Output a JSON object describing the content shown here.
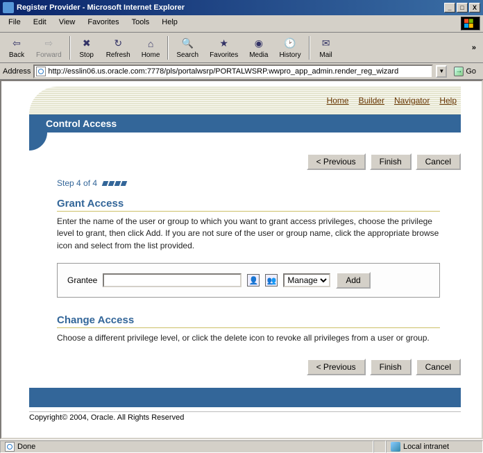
{
  "window": {
    "title": "Register Provider - Microsoft Internet Explorer"
  },
  "menubar": {
    "file": "File",
    "edit": "Edit",
    "view": "View",
    "favorites": "Favorites",
    "tools": "Tools",
    "help": "Help"
  },
  "toolbar": {
    "back": "Back",
    "forward": "Forward",
    "stop": "Stop",
    "refresh": "Refresh",
    "home": "Home",
    "search": "Search",
    "favorites": "Favorites",
    "media": "Media",
    "history": "History",
    "mail": "Mail"
  },
  "address": {
    "label": "Address",
    "url": "http://esslin06.us.oracle.com:7778/pls/portalwsrp/PORTALWSRP.wwpro_app_admin.render_reg_wizard",
    "go": "Go"
  },
  "nav": {
    "home": "Home",
    "builder": "Builder",
    "navigator": "Navigator",
    "help": "Help"
  },
  "header": {
    "title": "Control Access"
  },
  "wiz": {
    "prev": "< Previous",
    "finish": "Finish",
    "cancel": "Cancel"
  },
  "step": {
    "label": "Step 4 of 4"
  },
  "grant": {
    "title": "Grant Access",
    "body": "Enter the name of the user or group to which you want to grant access privileges, choose the privilege level to grant, then click Add. If you are not sure of the user or group name, click the appropriate browse icon and select from the list provided.",
    "grantee_label": "Grantee",
    "privilege_options": [
      "Manage"
    ],
    "privilege_selected": "Manage",
    "grantee_value": "",
    "add": "Add"
  },
  "change": {
    "title": "Change Access",
    "body": "Choose a different privilege level, or click the delete icon to revoke all privileges from a user or group."
  },
  "copyright": "Copyright© 2004, Oracle. All Rights Reserved",
  "status": {
    "left": "Done",
    "right": "Local intranet"
  }
}
